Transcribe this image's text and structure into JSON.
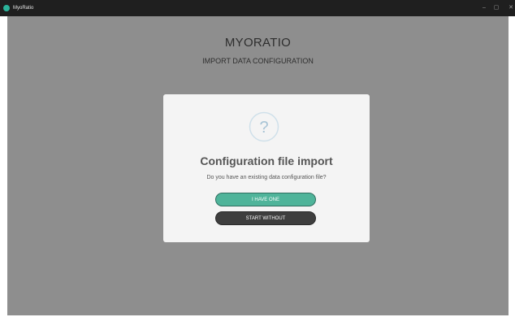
{
  "window": {
    "app_title": "MyoRatio",
    "minimize_glyph": "–",
    "maximize_glyph": "▢",
    "close_glyph": "✕"
  },
  "header": {
    "brand": "MYORATIO",
    "subtitle": "IMPORT DATA CONFIGURATION"
  },
  "dialog": {
    "icon": "question-circle-icon",
    "icon_glyph": "?",
    "title": "Configuration file import",
    "text": "Do you have an existing data configuration file?",
    "primary_button": "I HAVE ONE",
    "secondary_button": "START WITHOUT"
  },
  "colors": {
    "accent": "#4fb49a",
    "overlay": "#8e8e8e",
    "dark_button": "#3e3e3e",
    "titlebar": "#1f1f1f"
  }
}
